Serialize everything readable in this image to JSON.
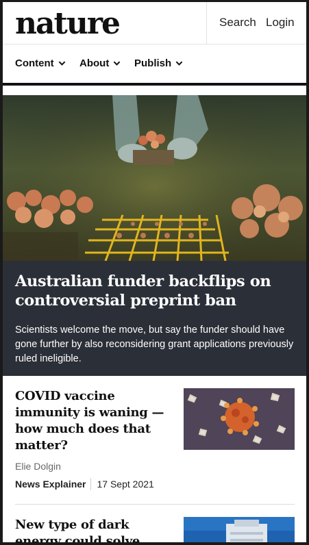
{
  "header": {
    "logo": "nature",
    "search_label": "Search",
    "login_label": "Login"
  },
  "nav": {
    "items": [
      {
        "label": "Content"
      },
      {
        "label": "About"
      },
      {
        "label": "Publish"
      }
    ]
  },
  "hero": {
    "title": "Australian funder backflips on controversial preprint ban",
    "subtitle": "Scientists welcome the move, but say the funder should have gone further by also reconsidering grant applications previously ruled ineligible."
  },
  "articles": [
    {
      "title": "COVID vaccine immunity is waning — how much does that matter?",
      "author": "Elie Dolgin",
      "type": "News Explainer",
      "date": "17 Sept 2021"
    },
    {
      "title": "New type of dark energy could solve Universe"
    }
  ],
  "colors": {
    "hero_bg": "#2b2f38",
    "accent_dark": "#111111"
  }
}
